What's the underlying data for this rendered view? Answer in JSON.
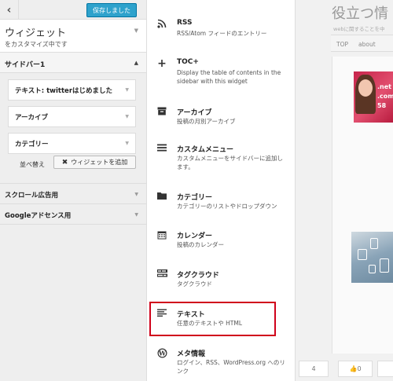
{
  "header": {
    "back_icon": "chevron-left-icon",
    "save_label": "保存しました"
  },
  "panel": {
    "title": "ウィジェット",
    "subtitle": "をカスタマイズ中です"
  },
  "sidebar_section": {
    "label": "サイドバー1",
    "widgets": [
      {
        "label": "テキスト: twitterはじめました"
      },
      {
        "label": "アーカイブ"
      },
      {
        "label": "カテゴリー"
      }
    ],
    "reorder_label": "並べ替え",
    "add_widget_label": "ウィジェットを追加"
  },
  "other_sections": [
    {
      "label": "スクロール広告用"
    },
    {
      "label": "Googleアドセンス用"
    }
  ],
  "available_widgets": [
    {
      "icon": "rss-icon",
      "name": "RSS",
      "desc": "RSS/Atom フィードのエントリー"
    },
    {
      "icon": "plus-icon",
      "name": "TOC+",
      "desc": "Display the table of contents in the sidebar with this widget"
    },
    {
      "icon": "archive-icon",
      "name": "アーカイブ",
      "desc": "投稿の月別アーカイブ"
    },
    {
      "icon": "menu-icon",
      "name": "カスタムメニュー",
      "desc": "カスタムメニューをサイドバーに追加します。"
    },
    {
      "icon": "folder-icon",
      "name": "カテゴリー",
      "desc": "カテゴリーのリストやドロップダウン"
    },
    {
      "icon": "calendar-icon",
      "name": "カレンダー",
      "desc": "投稿のカレンダー"
    },
    {
      "icon": "tag-cloud-icon",
      "name": "タグクラウド",
      "desc": "タグクラウド"
    },
    {
      "icon": "text-icon",
      "name": "テキスト",
      "desc": "任意のテキストや HTML"
    },
    {
      "icon": "wordpress-icon",
      "name": "メタ情報",
      "desc": "ログイン、RSS、WordPress.org へのリンク"
    }
  ],
  "preview": {
    "site_title": "役立つ情",
    "site_desc": "webに関することを中",
    "nav": [
      "TOP",
      "about"
    ],
    "thumb1_text": ".net\n.com\n58",
    "bottom_count": "4",
    "like_count": "0"
  },
  "colors": {
    "accent": "#2ea2cc",
    "highlight": "#d0021b"
  }
}
